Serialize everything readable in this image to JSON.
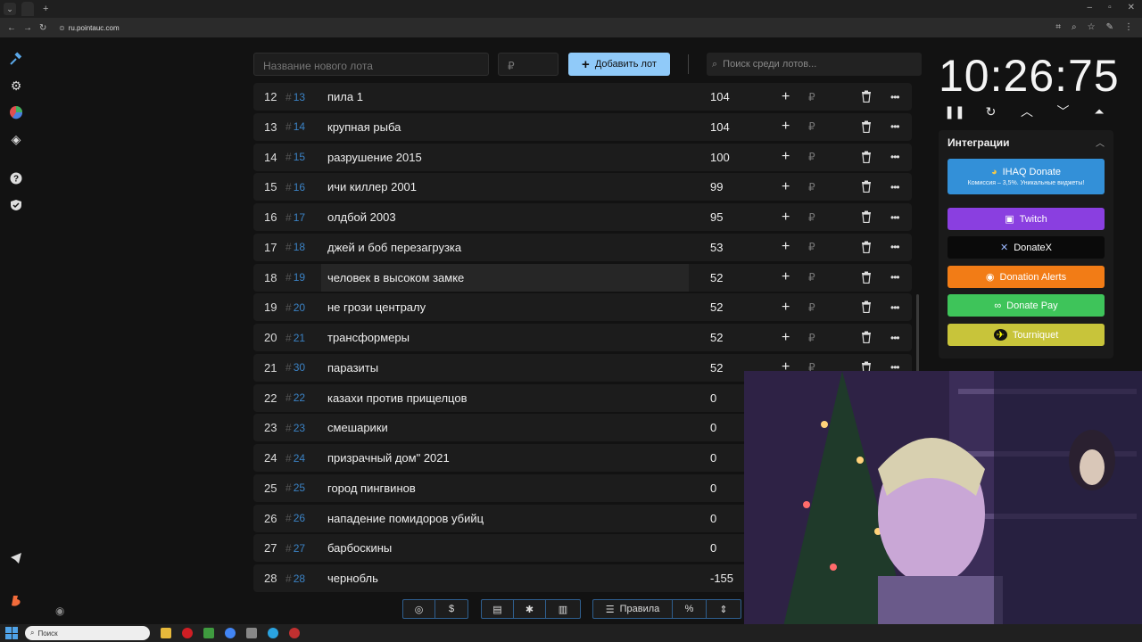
{
  "browser": {
    "url": "ru.pointauc.com"
  },
  "toolbar": {
    "new_lot_placeholder": "Название нового лота",
    "price_placeholder": "₽",
    "add_button": "Добавить лот",
    "search_placeholder": "Поиск среди лотов..."
  },
  "timer": {
    "time": "10:26:75"
  },
  "integrations": {
    "title": "Интеграции",
    "buttons": [
      {
        "label": "IHAQ Donate",
        "sub": "Комиссия – 3,5%. Уникальные виджеты!",
        "color": "#3390d8"
      },
      {
        "label": "Twitch",
        "color": "#8a3fe0"
      },
      {
        "label": "DonateX",
        "color": "#0a0a0a"
      },
      {
        "label": "Donation Alerts",
        "color": "#f27c16"
      },
      {
        "label": "Donate Pay",
        "color": "#3ec45a"
      },
      {
        "label": "Tourniquet",
        "color": "#c8c43a"
      }
    ]
  },
  "lots": [
    {
      "idx": "12",
      "id": "13",
      "name": "пила 1",
      "amount": "104"
    },
    {
      "idx": "13",
      "id": "14",
      "name": "крупная рыба",
      "amount": "104"
    },
    {
      "idx": "14",
      "id": "15",
      "name": "разрушение 2015",
      "amount": "100"
    },
    {
      "idx": "15",
      "id": "16",
      "name": "ичи киллер 2001",
      "amount": "99"
    },
    {
      "idx": "16",
      "id": "17",
      "name": "олдбой 2003",
      "amount": "95"
    },
    {
      "idx": "17",
      "id": "18",
      "name": "джей и боб перезагрузка",
      "amount": "53"
    },
    {
      "idx": "18",
      "id": "19",
      "name": "человек в высоком замке",
      "amount": "52"
    },
    {
      "idx": "19",
      "id": "20",
      "name": "не грози централу",
      "amount": "52"
    },
    {
      "idx": "20",
      "id": "21",
      "name": "трансформеры",
      "amount": "52"
    },
    {
      "idx": "21",
      "id": "30",
      "name": "паразиты",
      "amount": "52"
    },
    {
      "idx": "22",
      "id": "22",
      "name": "казахи против прищелцов",
      "amount": "0"
    },
    {
      "idx": "23",
      "id": "23",
      "name": "смешарики",
      "amount": "0"
    },
    {
      "idx": "24",
      "id": "24",
      "name": "призрачный дом\" 2021",
      "amount": "0"
    },
    {
      "idx": "25",
      "id": "25",
      "name": "город пингвинов",
      "amount": "0"
    },
    {
      "idx": "26",
      "id": "26",
      "name": "нападение помидоров убийц",
      "amount": "0"
    },
    {
      "idx": "27",
      "id": "27",
      "name": "барбоскины",
      "amount": "0"
    },
    {
      "idx": "28",
      "id": "28",
      "name": "чернобль",
      "amount": "-155"
    }
  ],
  "bottom_bar": {
    "rules_label": "Правила"
  },
  "taskbar": {
    "search_label": "Поиск"
  }
}
